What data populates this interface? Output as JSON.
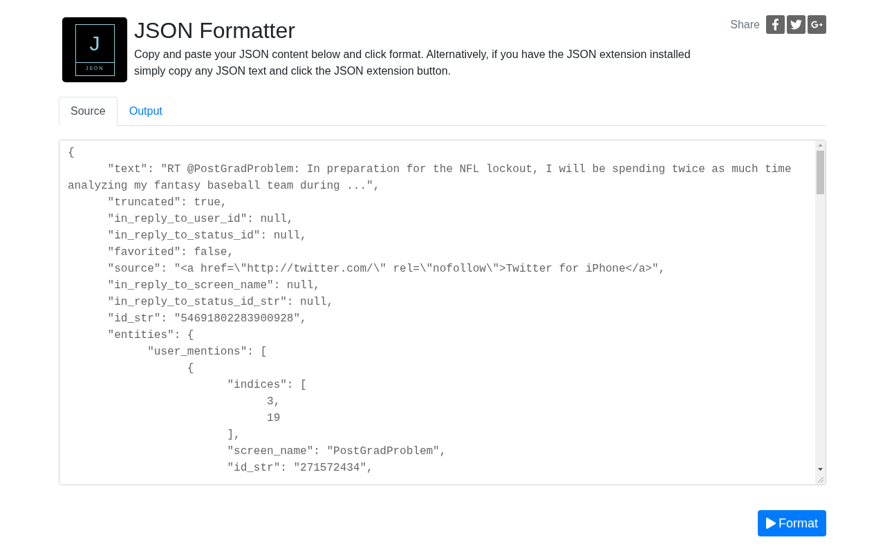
{
  "header": {
    "logo": {
      "letter": "J",
      "caption": "JSON"
    },
    "title": "JSON Formatter",
    "description": "Copy and paste your JSON content below and click format. Alternatively, if you have the JSON extension installed simply copy any JSON text and click the JSON extension button.",
    "share": {
      "label": "Share",
      "buttons": [
        {
          "kind": "facebook"
        },
        {
          "kind": "twitter"
        },
        {
          "kind": "google-plus"
        }
      ]
    }
  },
  "tabs": [
    {
      "label": "Source",
      "selected": true
    },
    {
      "label": "Output",
      "selected": false
    }
  ],
  "editor": {
    "value": "{\n\t\"text\": \"RT @PostGradProblem: In preparation for the NFL lockout, I will be spending twice as much time analyzing my fantasy baseball team during ...\",\n\t\"truncated\": true,\n\t\"in_reply_to_user_id\": null,\n\t\"in_reply_to_status_id\": null,\n\t\"favorited\": false,\n\t\"source\": \"<a href=\\\"http://twitter.com/\\\" rel=\\\"nofollow\\\">Twitter for iPhone</a>\",\n\t\"in_reply_to_screen_name\": null,\n\t\"in_reply_to_status_id_str\": null,\n\t\"id_str\": \"54691802283900928\",\n\t\"entities\": {\n\t\t\"user_mentions\": [\n\t\t\t{\n\t\t\t\t\"indices\": [\n\t\t\t\t\t3,\n\t\t\t\t\t19\n\t\t\t\t],\n\t\t\t\t\"screen_name\": \"PostGradProblem\",\n\t\t\t\t\"id_str\": \"271572434\","
  },
  "format_button": {
    "label": "Format"
  }
}
